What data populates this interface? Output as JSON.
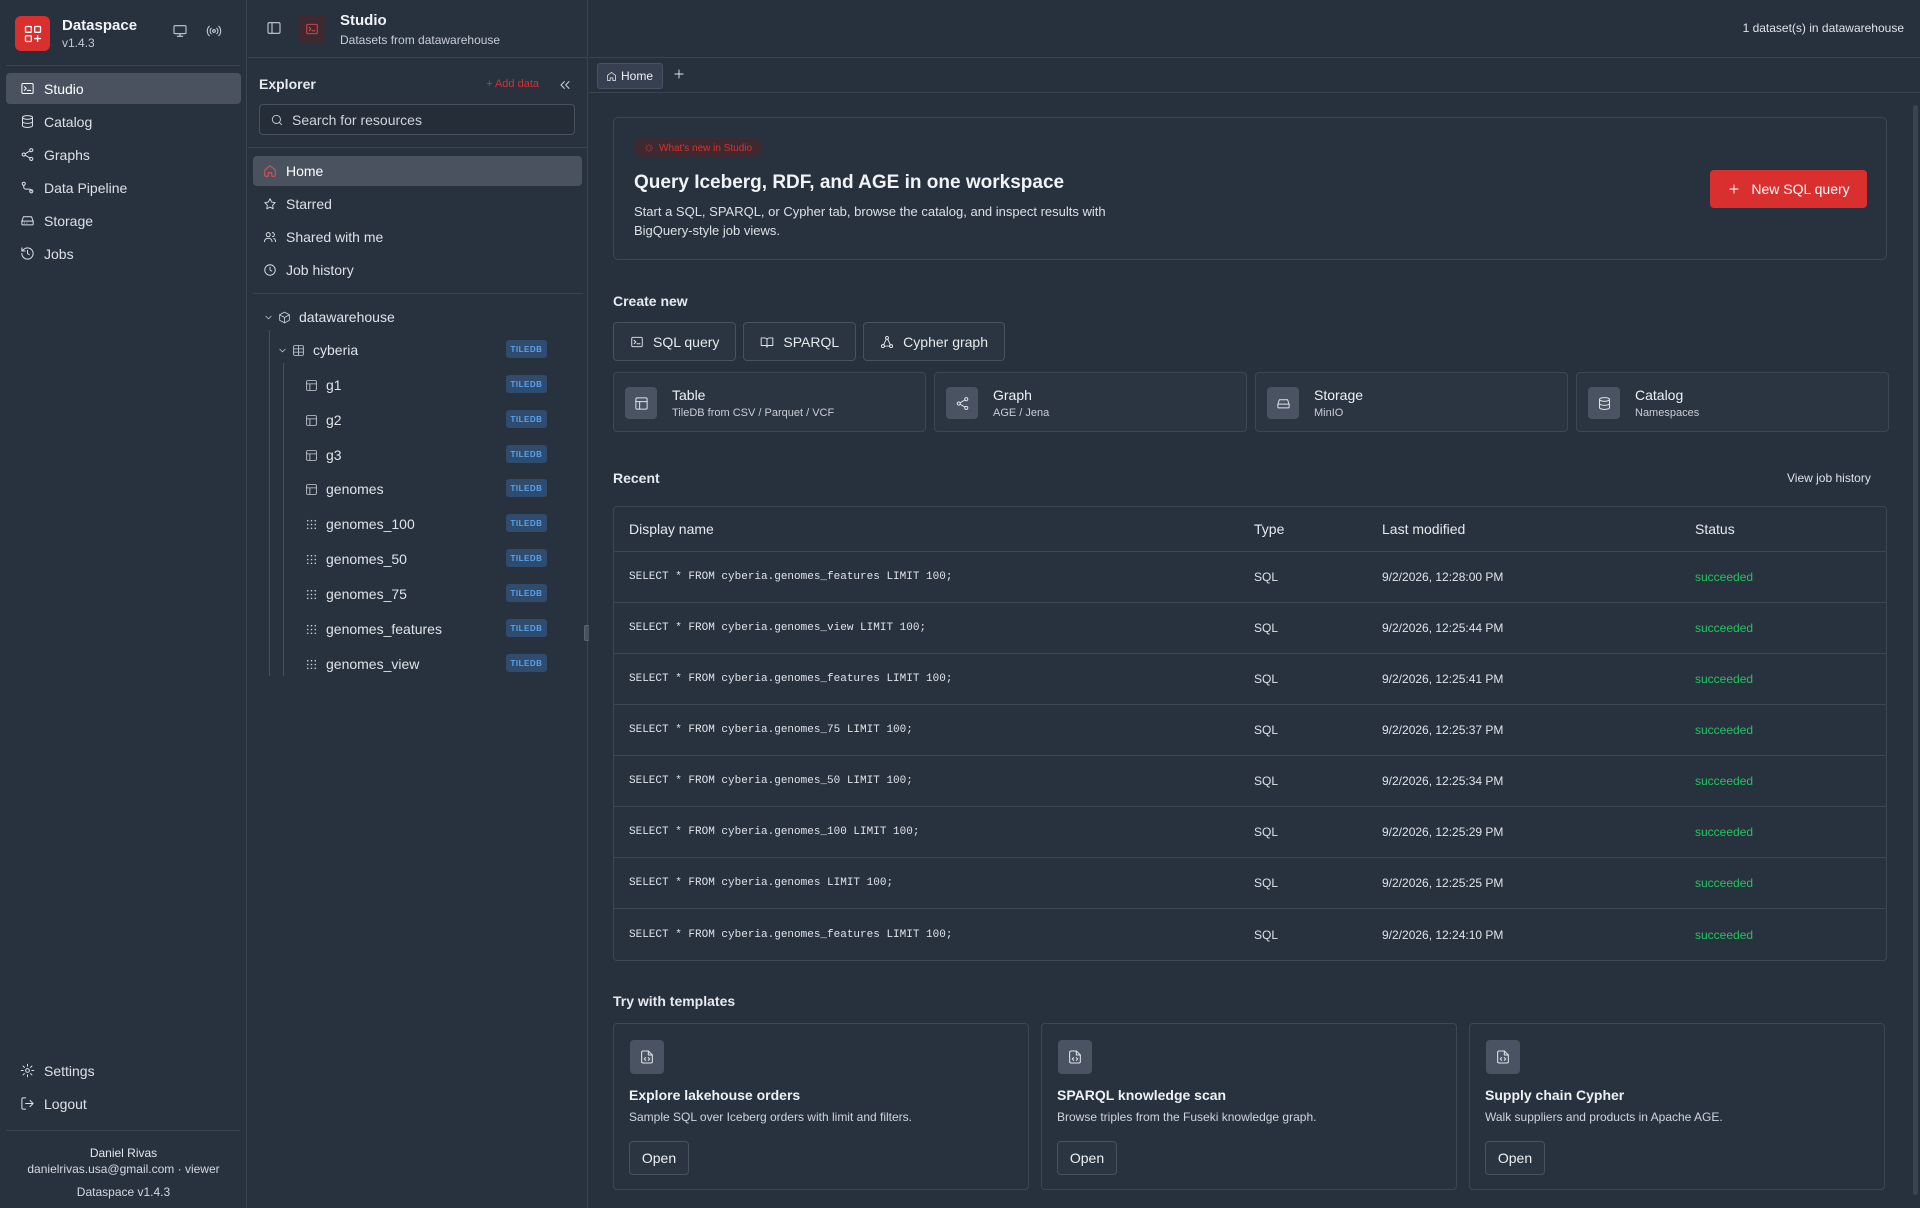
{
  "app": {
    "name": "Dataspace",
    "version": "v1.4.3",
    "accent": "#d9302f",
    "live_color": "#22c55e"
  },
  "nav": {
    "items": [
      {
        "label": "Studio",
        "icon": "terminal-icon",
        "active": true
      },
      {
        "label": "Catalog",
        "icon": "database-icon"
      },
      {
        "label": "Graphs",
        "icon": "share-icon"
      },
      {
        "label": "Data Pipeline",
        "icon": "workflow-icon"
      },
      {
        "label": "Storage",
        "icon": "hard-drive-icon"
      },
      {
        "label": "Jobs",
        "icon": "history-icon"
      }
    ],
    "settings": "Settings",
    "logout": "Logout"
  },
  "user": {
    "name": "Daniel Rivas",
    "email_role": "danielrivas.usa@gmail.com · viewer",
    "footer": "Dataspace v1.4.3"
  },
  "header": {
    "title": "Studio",
    "subtitle": "Datasets from datawarehouse",
    "dataset_count": "1 dataset(s) in datawarehouse"
  },
  "explorer": {
    "title": "Explorer",
    "add_data": "+ Add data",
    "search_placeholder": "Search for resources",
    "quick": {
      "home": "Home",
      "starred": "Starred",
      "shared": "Shared with me",
      "history": "Job history"
    },
    "tree": {
      "root": "datawarehouse",
      "namespace": "cyberia",
      "badge": "TILEDB",
      "tables": [
        "g1",
        "g2",
        "g3",
        "genomes",
        "genomes_100",
        "genomes_50",
        "genomes_75",
        "genomes_features",
        "genomes_view"
      ]
    }
  },
  "tabs": {
    "home": "Home"
  },
  "hero": {
    "pill": "What's new in Studio",
    "title": "Query Iceberg, RDF, and AGE in one workspace",
    "desc": "Start a SQL, SPARQL, or Cypher tab, browse the catalog, and inspect results with BigQuery-style job views.",
    "cta": "New SQL query"
  },
  "create": {
    "title": "Create new",
    "chips": [
      "SQL query",
      "SPARQL",
      "Cypher graph"
    ],
    "cards": [
      {
        "title": "Table",
        "sub": "TileDB from CSV / Parquet / VCF"
      },
      {
        "title": "Graph",
        "sub": "AGE / Jena"
      },
      {
        "title": "Storage",
        "sub": "MinIO"
      },
      {
        "title": "Catalog",
        "sub": "Namespaces"
      }
    ]
  },
  "recent": {
    "title": "Recent",
    "link": "View job history",
    "columns": [
      "Display name",
      "Type",
      "Last modified",
      "Status"
    ],
    "rows": [
      {
        "name": "SELECT * FROM cyberia.genomes_features LIMIT 100;",
        "type": "SQL",
        "modified": "9/2/2026, 12:28:00 PM",
        "status": "succeeded"
      },
      {
        "name": "SELECT * FROM cyberia.genomes_view LIMIT 100;",
        "type": "SQL",
        "modified": "9/2/2026, 12:25:44 PM",
        "status": "succeeded"
      },
      {
        "name": "SELECT * FROM cyberia.genomes_features LIMIT 100;",
        "type": "SQL",
        "modified": "9/2/2026, 12:25:41 PM",
        "status": "succeeded"
      },
      {
        "name": "SELECT * FROM cyberia.genomes_75 LIMIT 100;",
        "type": "SQL",
        "modified": "9/2/2026, 12:25:37 PM",
        "status": "succeeded"
      },
      {
        "name": "SELECT * FROM cyberia.genomes_50 LIMIT 100;",
        "type": "SQL",
        "modified": "9/2/2026, 12:25:34 PM",
        "status": "succeeded"
      },
      {
        "name": "SELECT * FROM cyberia.genomes_100 LIMIT 100;",
        "type": "SQL",
        "modified": "9/2/2026, 12:25:29 PM",
        "status": "succeeded"
      },
      {
        "name": "SELECT * FROM cyberia.genomes LIMIT 100;",
        "type": "SQL",
        "modified": "9/2/2026, 12:25:25 PM",
        "status": "succeeded"
      },
      {
        "name": "SELECT * FROM cyberia.genomes_features LIMIT 100;",
        "type": "SQL",
        "modified": "9/2/2026, 12:24:10 PM",
        "status": "succeeded"
      }
    ]
  },
  "templates": {
    "title": "Try with templates",
    "items": [
      {
        "title": "Explore lakehouse orders",
        "desc": "Sample SQL over Iceberg orders with limit and filters.",
        "button": "Open"
      },
      {
        "title": "SPARQL knowledge scan",
        "desc": "Browse triples from the Fuseki knowledge graph.",
        "button": "Open"
      },
      {
        "title": "Supply chain Cypher",
        "desc": "Walk suppliers and products in Apache AGE.",
        "button": "Open"
      }
    ]
  }
}
